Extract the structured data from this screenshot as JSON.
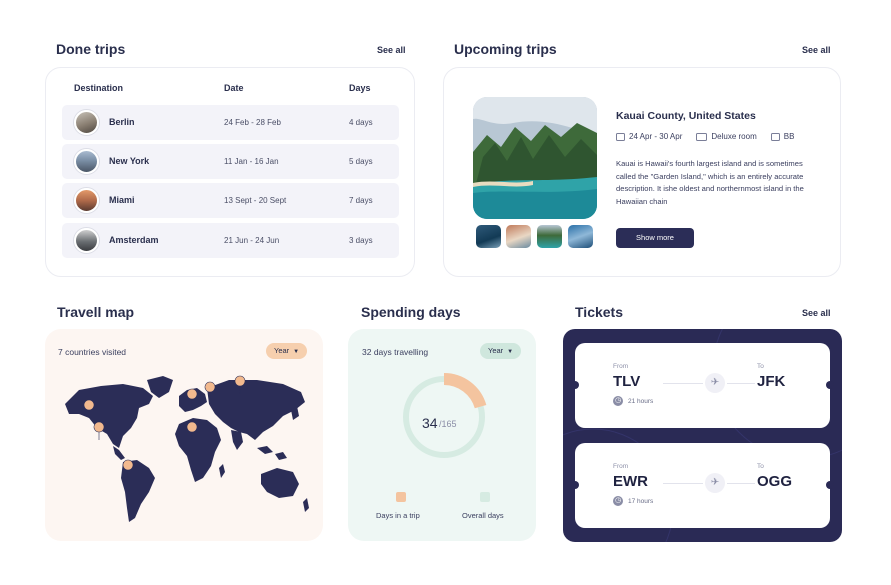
{
  "done_trips": {
    "title": "Done trips",
    "see_all": "See all",
    "columns": [
      "Destination",
      "Date",
      "Days"
    ],
    "rows": [
      {
        "city": "Berlin",
        "date": "24 Feb - 28 Feb",
        "days": "4 days",
        "color": "#8a7f72"
      },
      {
        "city": "New York",
        "date": "11 Jan - 16 Jan",
        "days": "5 days",
        "color": "#7b8fa6"
      },
      {
        "city": "Miami",
        "date": "13 Sept - 20 Sept",
        "days": "7 days",
        "color": "#b06a4a"
      },
      {
        "city": "Amsterdam",
        "date": "21 Jun - 24 Jun",
        "days": "3 days",
        "color": "#6a6e72"
      }
    ]
  },
  "upcoming": {
    "title": "Upcoming trips",
    "see_all": "See all",
    "place": "Kauai County, United States",
    "dates": "24 Apr - 30 Apr",
    "room": "Deluxe room",
    "board": "BB",
    "description": "Kauai is Hawaii's fourth largest island and is sometimes called the \"Garden Island,\" which is an entirely accurate description. It ishe oldest and northernmost island in the Hawaiian chain",
    "button": "Show more"
  },
  "travel_map": {
    "title": "Travell map",
    "visited": "7 countries visited",
    "filter": "Year",
    "pin_color": "#f2b98e",
    "land_color": "#2b2d57"
  },
  "spending": {
    "title": "Spending days",
    "label": "32 days travelling",
    "filter": "Year",
    "value": "34",
    "total": "/165",
    "trip_days": 34,
    "overall_days": 165,
    "legend_trip": "Days in a trip",
    "legend_overall": "Overall days",
    "trip_color": "#f4c49f",
    "overall_color": "#d6ebe2"
  },
  "tickets": {
    "title": "Tickets",
    "see_all": "See all",
    "items": [
      {
        "from_label": "From",
        "from": "TLV",
        "to_label": "To",
        "to": "JFK",
        "duration": "21 hours"
      },
      {
        "from_label": "From",
        "from": "EWR",
        "to_label": "To",
        "to": "OGG",
        "duration": "17 hours"
      }
    ]
  }
}
